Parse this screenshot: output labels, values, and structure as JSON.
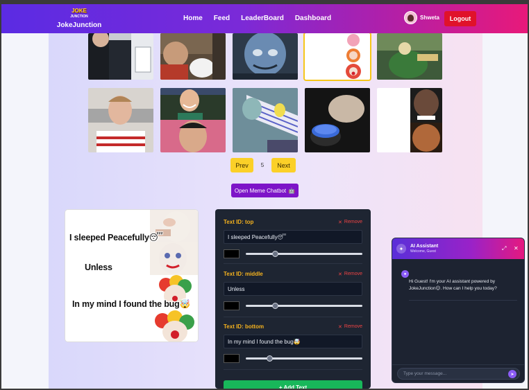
{
  "navbar": {
    "logo_text": "JOKE",
    "logo_subtext": "JUNCTION",
    "brand": "JokeJunction",
    "links": [
      "Home",
      "Feed",
      "LeaderBoard",
      "Dashboard"
    ],
    "username": "Shweta",
    "logout_label": "Logout"
  },
  "pagination": {
    "prev_label": "Prev",
    "page": "5",
    "next_label": "Next"
  },
  "chatbot_button": {
    "label": "Open Meme Chatbot",
    "icon": "🤖"
  },
  "meme_preview": {
    "captions": [
      "I sleeped Peacefully😴",
      "Unless",
      "In my mind I found the bug🤯"
    ]
  },
  "editor": {
    "fields": [
      {
        "label": "Text ID: top",
        "value": "I sleeped Peacefully😴",
        "remove": "Remove",
        "color": "#000000",
        "size": 0.25
      },
      {
        "label": "Text ID: middle",
        "value": "Unless",
        "remove": "Remove",
        "color": "#000000",
        "size": 0.25
      },
      {
        "label": "Text ID: bottom",
        "value": "In my mind I found the bug🤯",
        "remove": "Remove",
        "color": "#000000",
        "size": 0.2
      }
    ],
    "add_label": "+ Add Text"
  },
  "assistant": {
    "title": "AI Assistant",
    "subtitle": "Welcome, Guest",
    "message": "Hi Guest! I'm your AI assistant powered by JokeJunction😊. How can I help you today?",
    "input_placeholder": "Type your message..."
  },
  "colors": {
    "nav_gradient_start": "#5b2be3",
    "nav_gradient_end": "#e8197a",
    "logout": "#e0122a",
    "pager": "#fbd028",
    "chatbot_button": "#7d14c8",
    "field_label": "#f5b21e",
    "remove": "#f04444",
    "add_button": "#18b75a",
    "selected_border": "#f6c61a"
  }
}
